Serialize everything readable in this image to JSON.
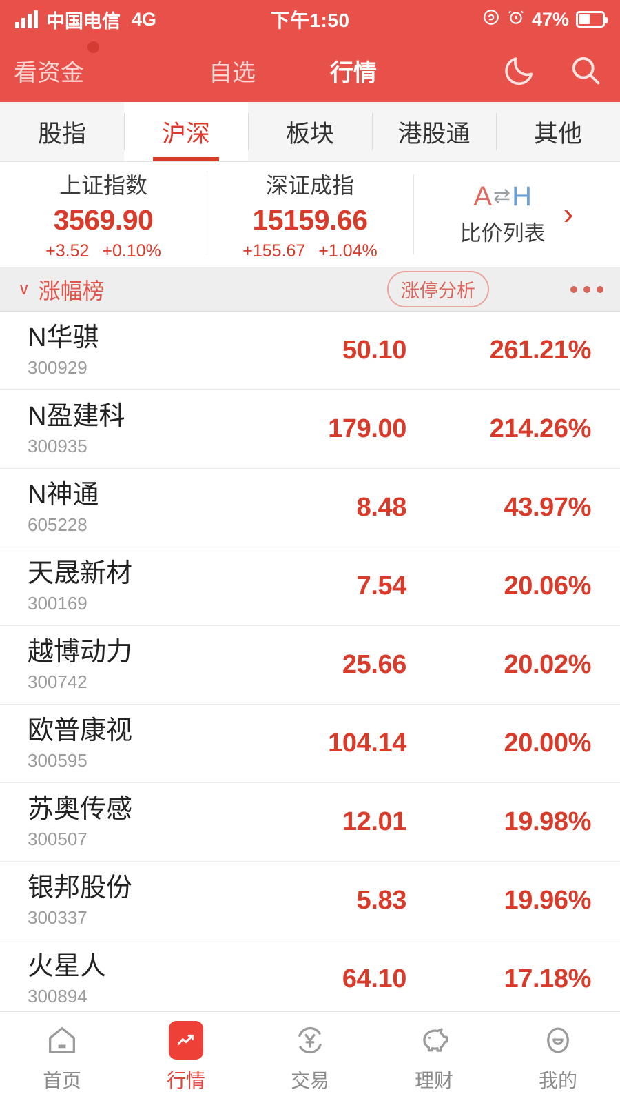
{
  "status_bar": {
    "carrier": "中国电信",
    "network": "4G",
    "time": "下午1:50",
    "battery_percent": "47%",
    "signal_icon": "signal-bars-icon",
    "alarm_icon": "alarm-clock-icon",
    "rotation_icon": "screen-rotation-lock-icon",
    "battery_icon": "battery-icon"
  },
  "header": {
    "fund_label": "看资金",
    "watchlist_label": "自选",
    "market_label": "行情",
    "night_mode_icon": "moon-icon",
    "search_icon": "search-icon",
    "badge": "notification-dot"
  },
  "category_tabs": [
    {
      "label": "股指",
      "active": false
    },
    {
      "label": "沪深",
      "active": true
    },
    {
      "label": "板块",
      "active": false
    },
    {
      "label": "港股通",
      "active": false
    },
    {
      "label": "其他",
      "active": false
    }
  ],
  "indices": [
    {
      "name": "上证指数",
      "value": "3569.90",
      "change": "+3.52",
      "change_percent": "+0.10%"
    },
    {
      "name": "深证成指",
      "value": "15159.66",
      "change": "+155.67",
      "change_percent": "+1.04%"
    }
  ],
  "ah_card": {
    "logo_a": "A",
    "logo_arrow": "⇄",
    "logo_h": "H",
    "label": "比价列表",
    "chevron": "›"
  },
  "section": {
    "title": "涨幅榜",
    "chevron": "∨",
    "pill_label": "涨停分析",
    "more_icon": "more-horizontal-icon"
  },
  "stocks": [
    {
      "name": "N华骐",
      "code": "300929",
      "price": "50.10",
      "change_percent": "261.21%"
    },
    {
      "name": "N盈建科",
      "code": "300935",
      "price": "179.00",
      "change_percent": "214.26%"
    },
    {
      "name": "N神通",
      "code": "605228",
      "price": "8.48",
      "change_percent": "43.97%"
    },
    {
      "name": "天晟新材",
      "code": "300169",
      "price": "7.54",
      "change_percent": "20.06%"
    },
    {
      "name": "越博动力",
      "code": "300742",
      "price": "25.66",
      "change_percent": "20.02%"
    },
    {
      "name": "欧普康视",
      "code": "300595",
      "price": "104.14",
      "change_percent": "20.00%"
    },
    {
      "name": "苏奥传感",
      "code": "300507",
      "price": "12.01",
      "change_percent": "19.98%"
    },
    {
      "name": "银邦股份",
      "code": "300337",
      "price": "5.83",
      "change_percent": "19.96%"
    },
    {
      "name": "火星人",
      "code": "300894",
      "price": "64.10",
      "change_percent": "17.18%"
    }
  ],
  "bottom_nav": [
    {
      "label": "首页",
      "icon": "home-icon",
      "active": false
    },
    {
      "label": "行情",
      "icon": "market-chart-icon",
      "active": true
    },
    {
      "label": "交易",
      "icon": "yuan-trade-icon",
      "active": false
    },
    {
      "label": "理财",
      "icon": "piggy-bank-icon",
      "active": false
    },
    {
      "label": "我的",
      "icon": "profile-icon",
      "active": false
    }
  ],
  "colors": {
    "brand_red": "#e8504a",
    "up_red": "#d93b2b",
    "muted_gray": "#9b9b9b"
  }
}
